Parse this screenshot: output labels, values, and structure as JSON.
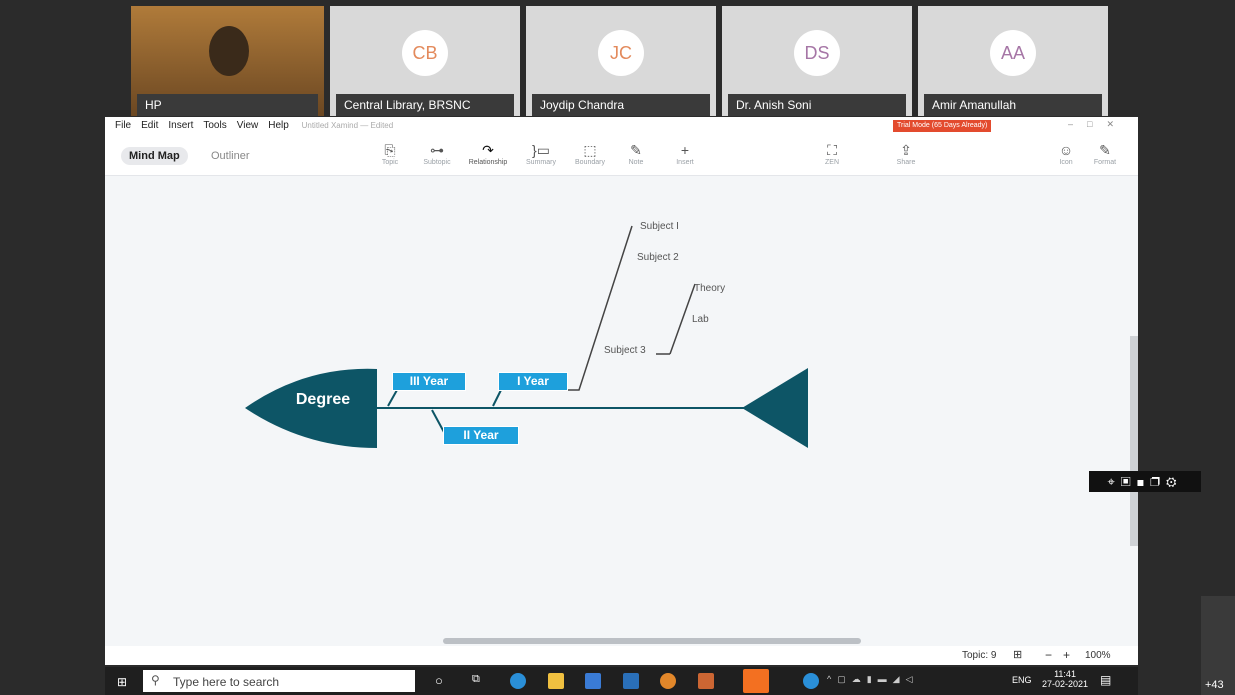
{
  "participants": [
    {
      "name": "HP",
      "initials": ""
    },
    {
      "name": "Central Library, BRSNC",
      "initials": "CB",
      "color": "#e38a5c"
    },
    {
      "name": "Joydip Chandra",
      "initials": "JC",
      "color": "#e38a5c"
    },
    {
      "name": "Dr. Anish Soni",
      "initials": "DS",
      "color": "#a676a6"
    },
    {
      "name": "Amir Amanullah",
      "initials": "AA",
      "color": "#a676a6"
    }
  ],
  "menu": {
    "items": [
      "File",
      "Edit",
      "Insert",
      "Tools",
      "View",
      "Help"
    ],
    "doc_title": "Untitled Xamind — Edited",
    "trial": "Trial Mode (65 Days Already)"
  },
  "toolbar": {
    "tab_mindmap": "Mind Map",
    "tab_outliner": "Outliner",
    "tools": [
      {
        "label": "Topic",
        "icon": "⎘"
      },
      {
        "label": "Subtopic",
        "icon": "⊶"
      },
      {
        "label": "Relationship",
        "icon": "↷"
      },
      {
        "label": "Summary",
        "icon": "}▭"
      },
      {
        "label": "Boundary",
        "icon": "⬚"
      },
      {
        "label": "Note",
        "icon": "✎"
      },
      {
        "label": "Insert",
        "icon": "+"
      }
    ],
    "zen": "ZEN",
    "share": "Share",
    "icon": "Icon",
    "format": "Format"
  },
  "diagram": {
    "head": "Degree",
    "b1": "III Year",
    "b2": "I Year",
    "b3": "II Year",
    "s1": "Subject I",
    "s2": "Subject 2",
    "s3": "Subject 3",
    "t1": "Theory",
    "t2": "Lab"
  },
  "status": {
    "topic": "Topic: 9",
    "zoom": "100%"
  },
  "taskbar": {
    "search": "Type here to search",
    "lang": "ENG",
    "time": "11:41",
    "date": "27-02-2021"
  },
  "side": {
    "count": "+43"
  },
  "colors": {
    "fish": "#0d5566",
    "box": "#1ea0dc",
    "trial": "#e34b2e"
  }
}
